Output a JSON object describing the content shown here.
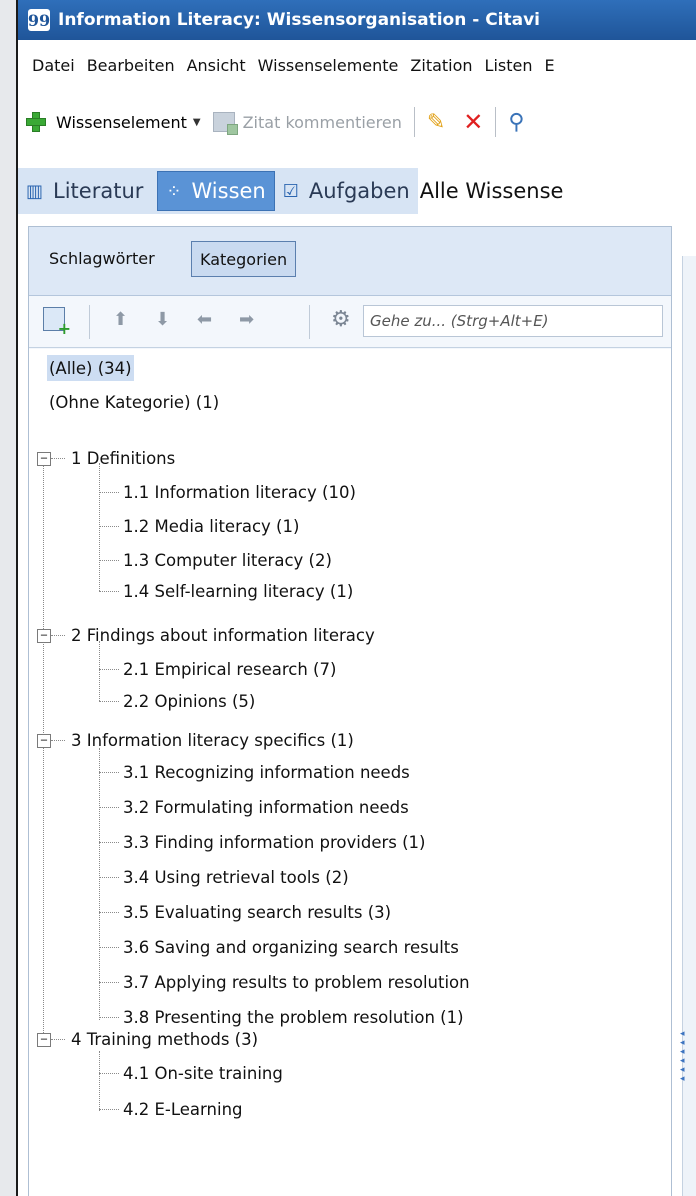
{
  "window": {
    "title": "Information Literacy: Wissensorganisation - Citavi",
    "logo_glyph": "99"
  },
  "menu": [
    "Datei",
    "Bearbeiten",
    "Ansicht",
    "Wissenselemente",
    "Zitation",
    "Listen",
    "E"
  ],
  "toolbar": {
    "new_element_label": "Wissenselement",
    "comment_citation_label": "Zitat kommentieren"
  },
  "nav": {
    "literature_label": "Literatur",
    "knowledge_label": "Wissen",
    "tasks_label": "Aufgaben",
    "extra_label": "Alle Wissense"
  },
  "panel": {
    "tab_keywords": "Schlagwörter",
    "tab_categories": "Kategorien",
    "goto_placeholder": "Gehe zu... (Strg+Alt+E)"
  },
  "tree": {
    "all": "(Alle) (34)",
    "none": "(Ohne Kategorie) (1)",
    "groups": [
      {
        "label": "1 Definitions",
        "children": [
          "1.1 Information literacy (10)",
          "1.2 Media literacy (1)",
          "1.3 Computer literacy (2)",
          "1.4 Self-learning literacy (1)"
        ]
      },
      {
        "label": "2 Findings about information literacy",
        "children": [
          "2.1 Empirical research (7)",
          "2.2 Opinions (5)"
        ]
      },
      {
        "label": "3 Information literacy specifics (1)",
        "children": [
          "3.1 Recognizing information needs",
          "3.2 Formulating information needs",
          "3.3 Finding information providers (1)",
          "3.4 Using retrieval tools (2)",
          "3.5 Evaluating search results (3)",
          "3.6 Saving and organizing search results",
          "3.7 Applying results to problem resolution",
          "3.8 Presenting the problem resolution (1)"
        ]
      },
      {
        "label": "4 Training methods (3)",
        "children": [
          "4.1 On-site training",
          "4.2 E-Learning"
        ]
      }
    ]
  },
  "colors": {
    "titlebar": "#1f5599",
    "nav_active": "#5a93d6",
    "selection": "#cdddf2"
  }
}
